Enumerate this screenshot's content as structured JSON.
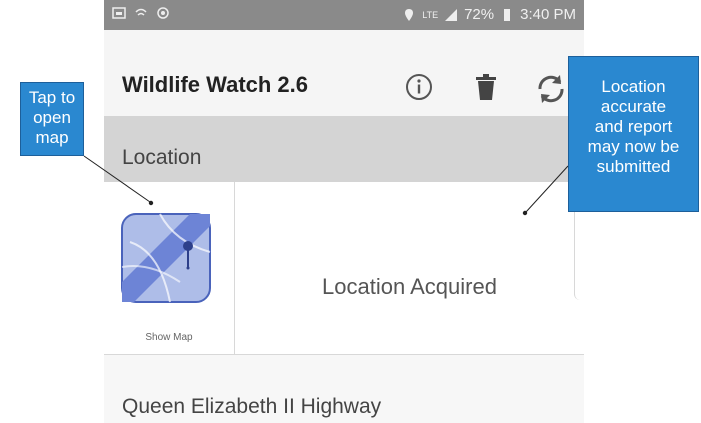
{
  "status_bar": {
    "battery_percent": "72%",
    "time": "3:40 PM",
    "network": "LTE"
  },
  "app_bar": {
    "title": "Wildlife Watch 2.6",
    "icons": [
      "info-icon",
      "trash-icon",
      "sync-icon"
    ]
  },
  "section": {
    "title": "Location"
  },
  "location_row": {
    "show_map_label": "Show Map",
    "status": "Location Acquired"
  },
  "road": {
    "name": "Queen Elizabeth II Highway"
  },
  "callouts": {
    "left": [
      "Tap to",
      "open",
      "map"
    ],
    "right": [
      "Location",
      "accurate",
      "and report",
      "may now be",
      "submitted"
    ]
  },
  "colors": {
    "callout_fill": "#2a88d0",
    "map_icon": "#6d84d6",
    "section_header": "#d4d4d4"
  }
}
